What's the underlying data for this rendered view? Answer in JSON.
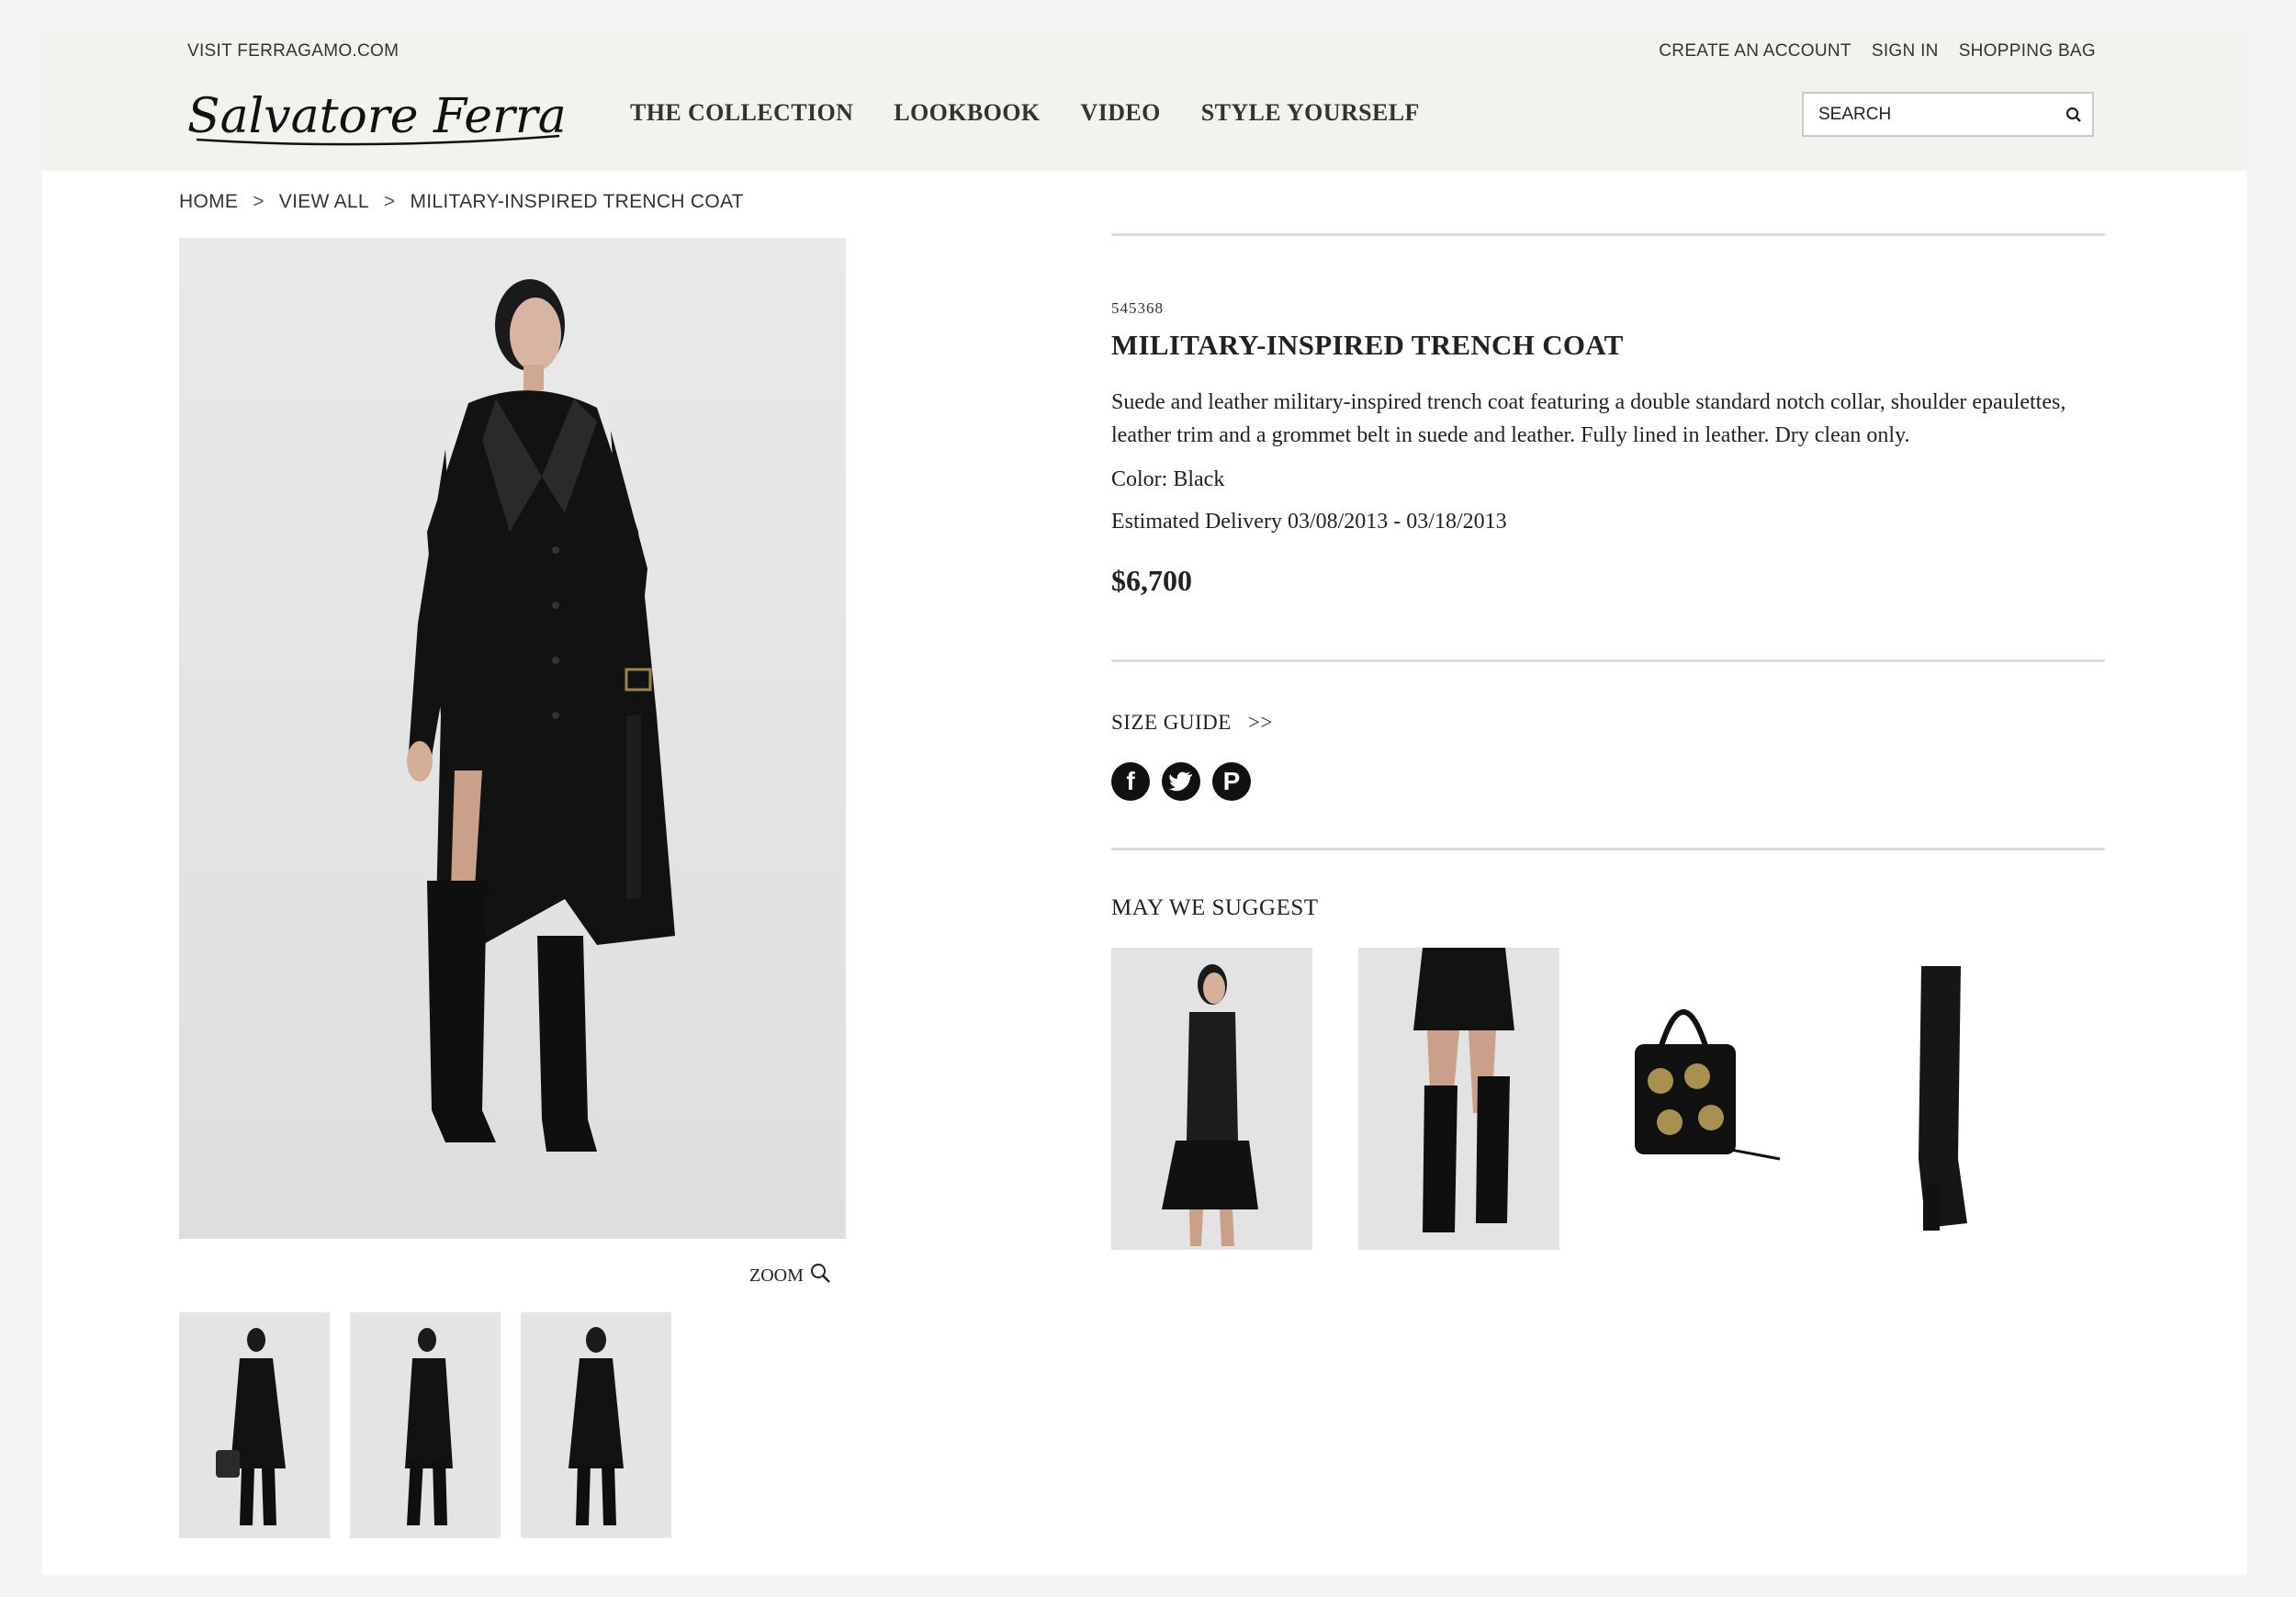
{
  "header": {
    "visit_link": "VISIT FERRAGAMO.COM",
    "brand": "Salvatore Ferragamo",
    "account_links": [
      "CREATE AN ACCOUNT",
      "SIGN IN",
      "SHOPPING BAG"
    ],
    "nav": [
      "THE COLLECTION",
      "LOOKBOOK",
      "VIDEO",
      "STYLE YOURSELF"
    ],
    "search_placeholder": "SEARCH"
  },
  "breadcrumb": {
    "items": [
      "HOME",
      "VIEW ALL",
      "MILITARY-INSPIRED TRENCH COAT"
    ],
    "separator": ">"
  },
  "product": {
    "sku": "545368",
    "title": "MILITARY-INSPIRED TRENCH COAT",
    "description": "Suede and leather military-inspired trench coat featuring a double standard notch collar, shoulder epaulettes, leather trim and a grommet belt in suede and leather. Fully lined in leather. Dry clean only.",
    "color": "Color: Black",
    "delivery": "Estimated Delivery 03/08/2013 - 03/18/2013",
    "price": "$6,700",
    "zoom_label": "ZOOM",
    "size_guide_label": "SIZE GUIDE",
    "size_guide_arrow": ">>",
    "social": [
      "facebook-icon",
      "twitter-icon",
      "pinterest-icon"
    ]
  },
  "suggest": {
    "title": "MAY WE SUGGEST"
  },
  "colors": {
    "header_bg": "#f4f2ef",
    "text": "#222222",
    "rule": "#dcdcdc"
  }
}
